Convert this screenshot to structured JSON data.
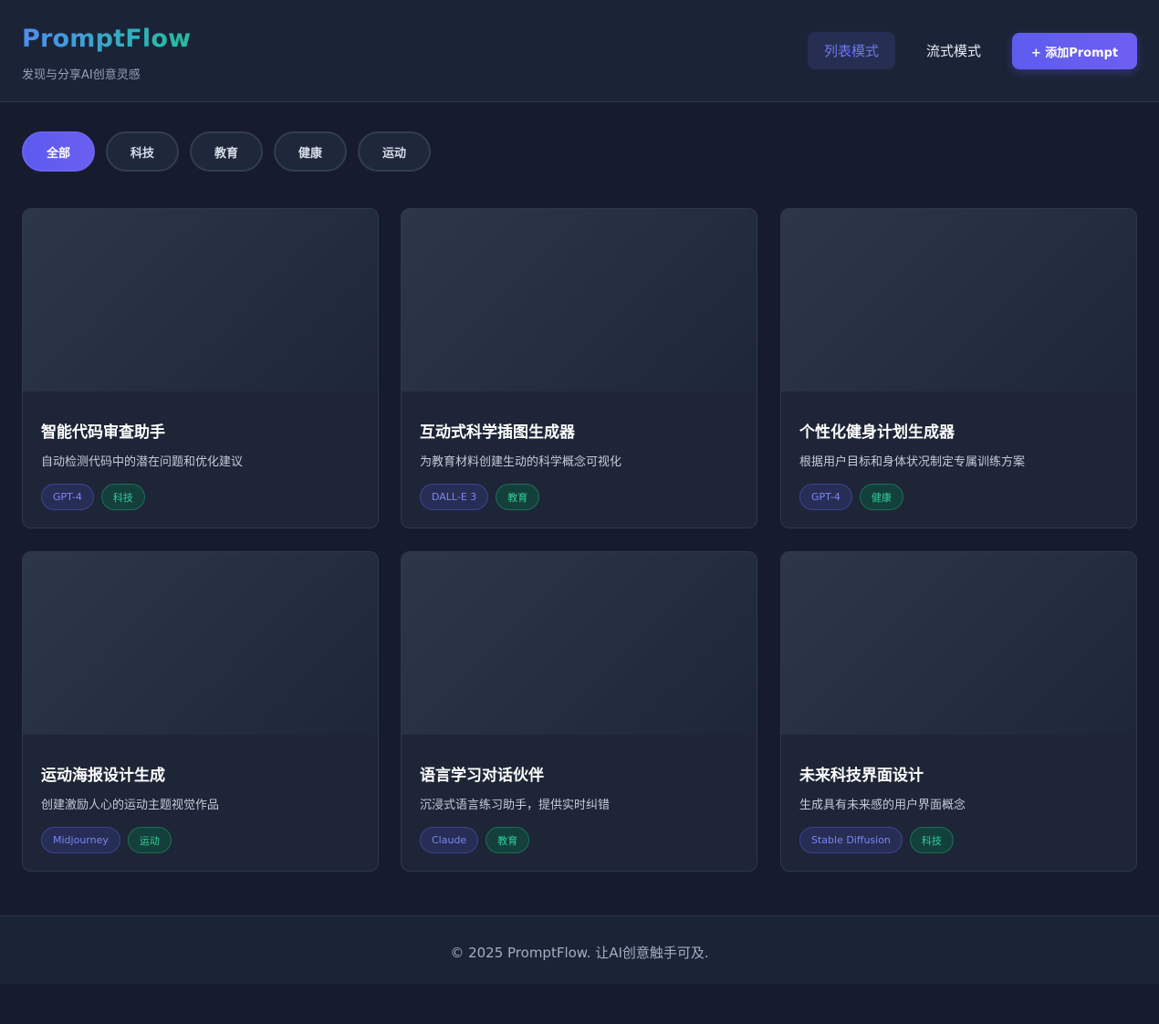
{
  "header": {
    "title": "PromptFlow",
    "subtitle": "发现与分享AI创意灵感",
    "view_list_label": "列表模式",
    "view_flow_label": "流式模式",
    "add_label": "+ 添加Prompt"
  },
  "filters": {
    "items": [
      {
        "label": "全部",
        "active": true
      },
      {
        "label": "科技",
        "active": false
      },
      {
        "label": "教育",
        "active": false
      },
      {
        "label": "健康",
        "active": false
      },
      {
        "label": "运动",
        "active": false
      }
    ]
  },
  "cards": [
    {
      "title": "智能代码审查助手",
      "description": "自动检测代码中的潜在问题和优化建议",
      "model": "GPT-4",
      "category": "科技"
    },
    {
      "title": "互动式科学插图生成器",
      "description": "为教育材料创建生动的科学概念可视化",
      "model": "DALL-E 3",
      "category": "教育"
    },
    {
      "title": "个性化健身计划生成器",
      "description": "根据用户目标和身体状况制定专属训练方案",
      "model": "GPT-4",
      "category": "健康"
    },
    {
      "title": "运动海报设计生成",
      "description": "创建激励人心的运动主题视觉作品",
      "model": "Midjourney",
      "category": "运动"
    },
    {
      "title": "语言学习对话伙伴",
      "description": "沉浸式语言练习助手，提供实时纠错",
      "model": "Claude",
      "category": "教育"
    },
    {
      "title": "未来科技界面设计",
      "description": "生成具有未来感的用户界面概念",
      "model": "Stable Diffusion",
      "category": "科技"
    }
  ],
  "footer": {
    "text": "© 2025 PromptFlow. 让AI创意触手可及."
  },
  "colors": {
    "accent": "#6366f1",
    "category_green": "#2fcf98",
    "background": "#161c2e"
  }
}
